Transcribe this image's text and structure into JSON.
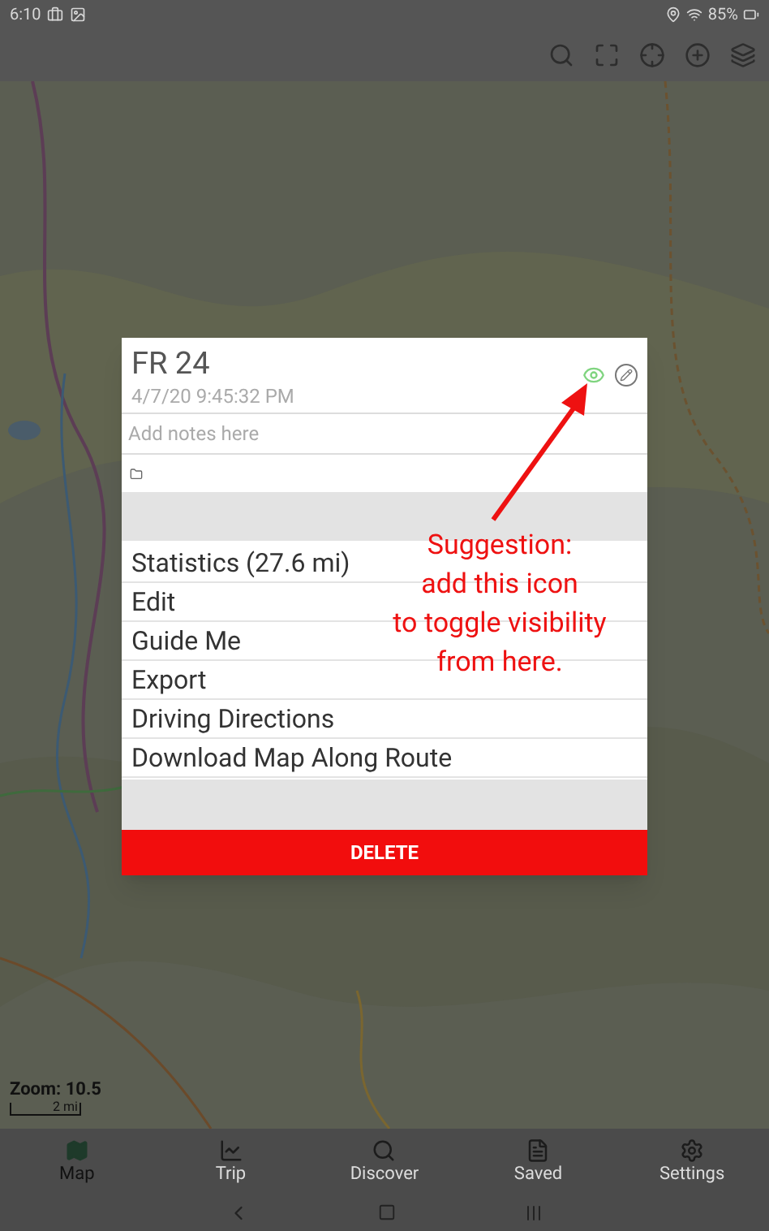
{
  "status_bar": {
    "time": "6:10",
    "battery": "85%"
  },
  "map": {
    "zoom_label": "Zoom: 10.5",
    "scale_label": "2 mi"
  },
  "dialog": {
    "title": "FR 24",
    "date": "4/7/20 9:45:32 PM",
    "visible": true,
    "notes": {
      "placeholder": "Add notes here"
    },
    "actions": [
      "Statistics (27.6 mi)",
      "Edit",
      "Guide Me",
      "Export",
      "Driving Directions",
      "Download Map Along Route"
    ],
    "delete_label": "DELETE"
  },
  "annotation": {
    "lines": [
      "Suggestion:",
      "add this icon",
      "to toggle visibility",
      "from here."
    ]
  },
  "bottom_nav": [
    {
      "label": "Map",
      "selected": true
    },
    {
      "label": "Trip",
      "selected": false
    },
    {
      "label": "Discover",
      "selected": false
    },
    {
      "label": "Saved",
      "selected": false
    },
    {
      "label": "Settings",
      "selected": false
    }
  ]
}
